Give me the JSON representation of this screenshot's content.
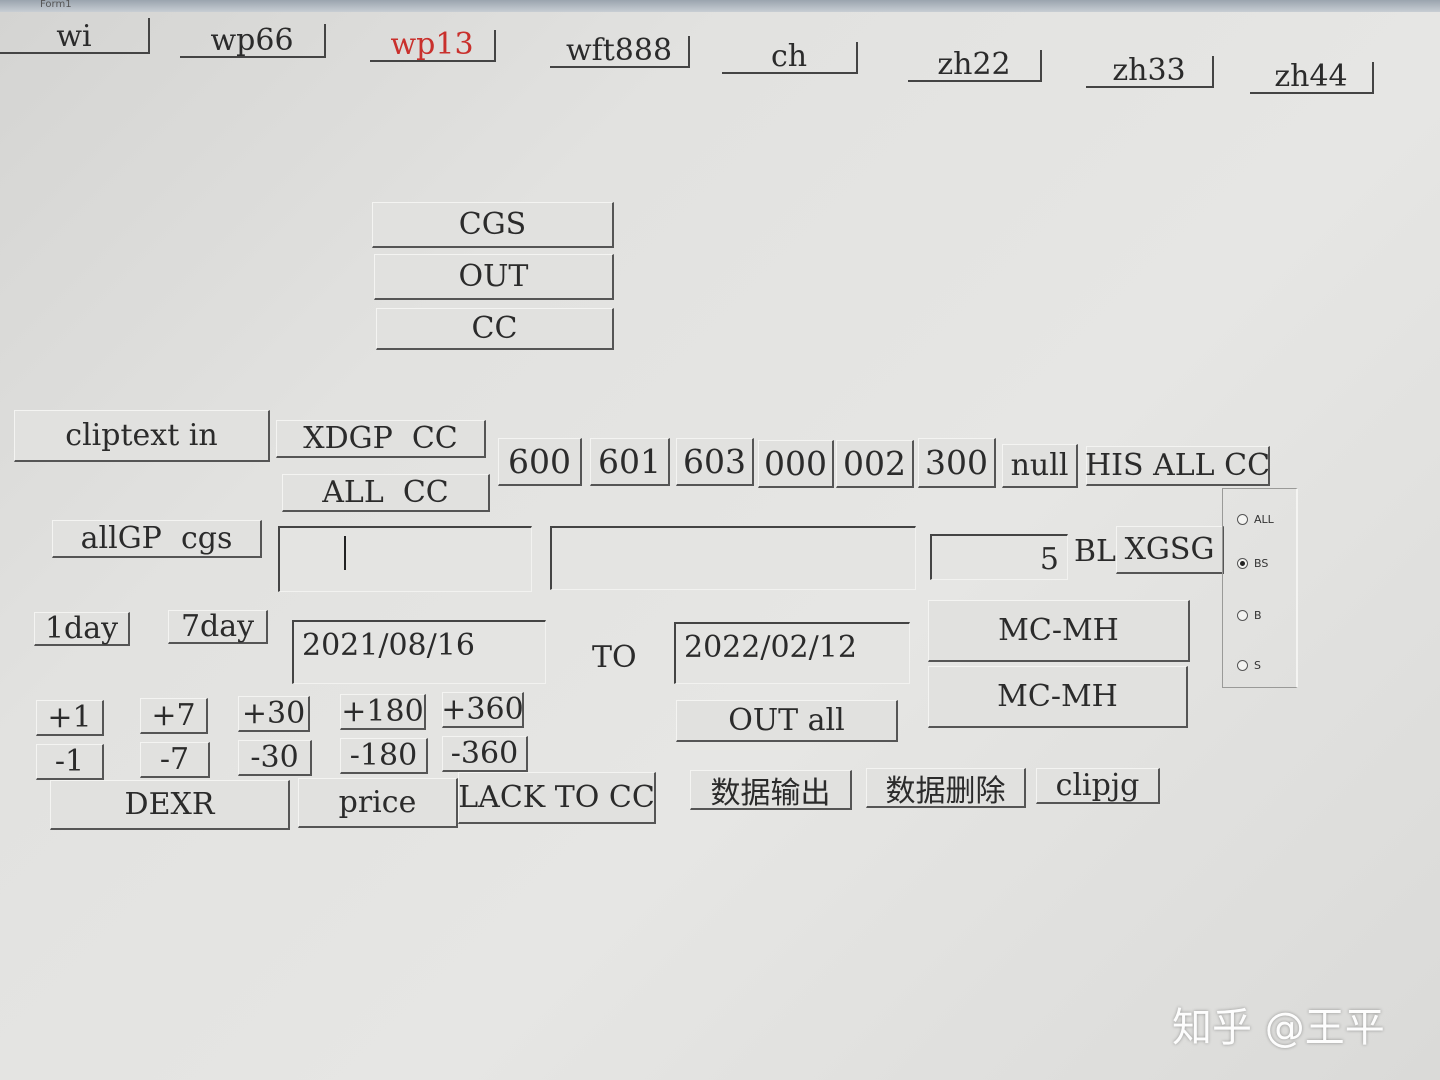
{
  "window": {
    "title": "Form1"
  },
  "tabs": [
    "wi",
    "wp66",
    "wp13",
    "wft888",
    "ch",
    "zh22",
    "zh33",
    "zh44"
  ],
  "colors": {
    "active_tab": "#c9302c"
  },
  "action_buttons": {
    "cgs": "CGS",
    "out": "OUT",
    "cc": "CC"
  },
  "clip": {
    "cliptext_in": "cliptext in",
    "xdgp_cc": "XDGP  CC",
    "all_cc": "ALL  CC",
    "allgp_cgs": "allGP  cgs"
  },
  "codes": [
    "600",
    "601",
    "603",
    "000",
    "002",
    "300"
  ],
  "null_button": "null",
  "his_all_cc": "HIS ALL CC",
  "bl": {
    "value": "5",
    "label": "BL",
    "xgsg": "XGSG"
  },
  "radio": {
    "options": [
      "ALL",
      "BS",
      "B",
      "S"
    ],
    "selected": "BS"
  },
  "dates": {
    "day1": "1day",
    "day7": "7day",
    "from": "2021/08/16",
    "to_label": "TO",
    "to": "2022/02/12",
    "out_all": "OUT all"
  },
  "mc": {
    "top": "MC-MH",
    "bottom": "MC-MH"
  },
  "plus": [
    "+1",
    "+7",
    "+30",
    "+180",
    "+360"
  ],
  "minus": [
    "-1",
    "-7",
    "-30",
    "-180",
    "-360"
  ],
  "bottom": {
    "dexr": "DEXR",
    "price": "price",
    "lack": "LACK TO CC",
    "data_out": "数据输出",
    "data_delete": "数据删除",
    "clipjg": "clipjg"
  },
  "watermark": "知乎 @王平"
}
